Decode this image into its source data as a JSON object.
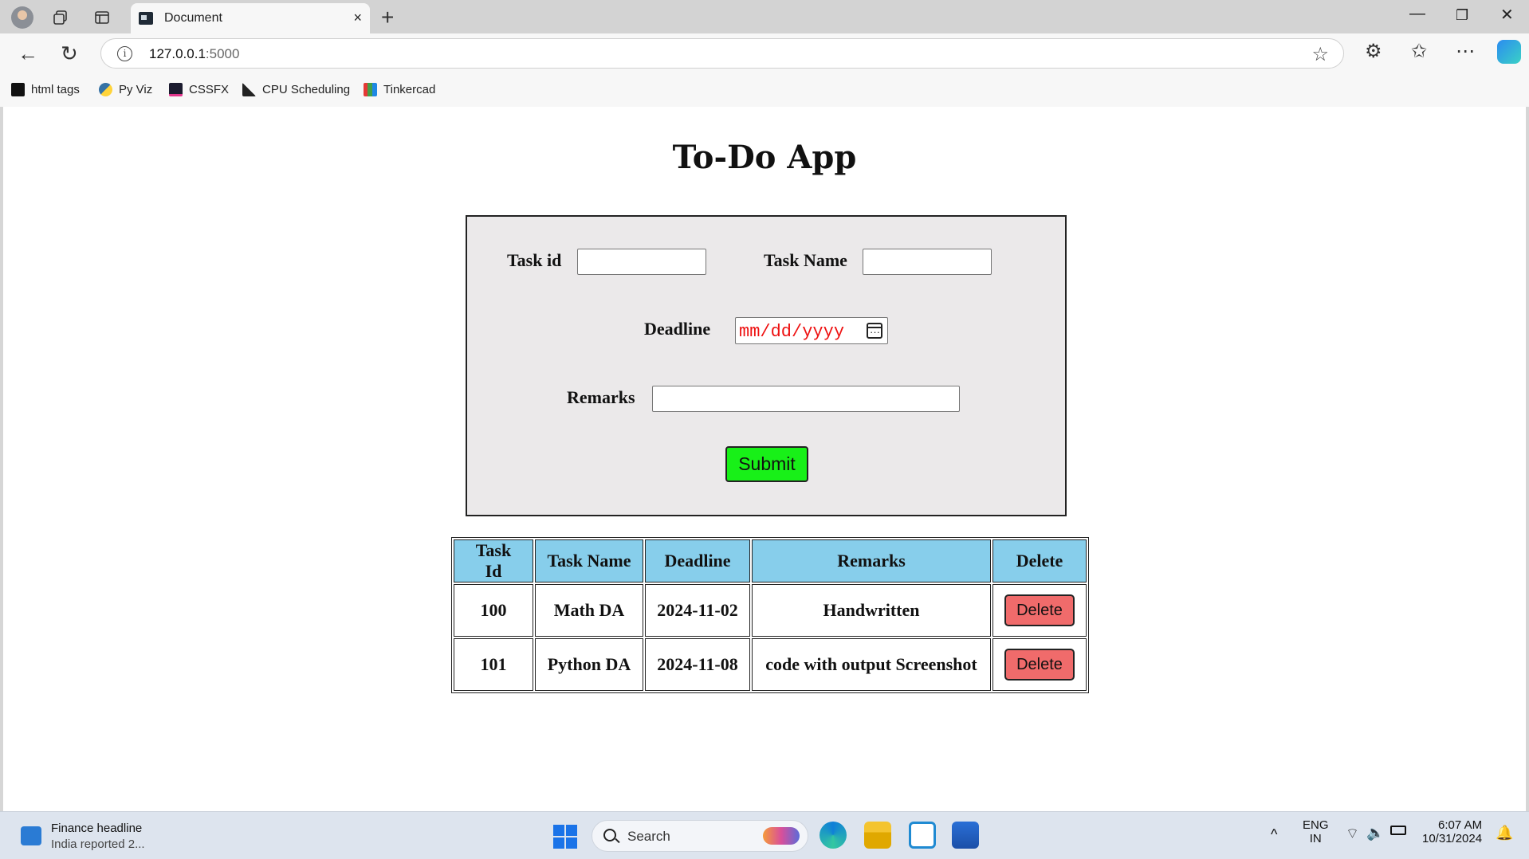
{
  "browser": {
    "tab_title": "Document",
    "tab_close": "×",
    "new_tab": "+",
    "address_host": "127.0.0.1",
    "address_port": ":5000",
    "bookmarks": [
      "html tags",
      "Py Viz",
      "CSSFX",
      "CPU Scheduling",
      "Tinkercad"
    ]
  },
  "page": {
    "title": "To-Do App",
    "form": {
      "task_id_label": "Task id",
      "task_name_label": "Task Name",
      "deadline_label": "Deadline",
      "deadline_placeholder": "mm/dd/yyyy",
      "remarks_label": "Remarks",
      "submit_label": "Submit"
    },
    "table": {
      "headers": [
        "Task Id",
        "Task Name",
        "Deadline",
        "Remarks",
        "Delete"
      ],
      "rows": [
        {
          "id": "100",
          "name": "Math DA",
          "deadline": "2024-11-02",
          "remarks": "Handwritten",
          "delete_label": "Delete"
        },
        {
          "id": "101",
          "name": "Python DA",
          "deadline": "2024-11-08",
          "remarks": "code with output Screenshot",
          "delete_label": "Delete"
        }
      ]
    }
  },
  "taskbar": {
    "news_title": "Finance headline",
    "news_sub": "India reported 2...",
    "search_label": "Search",
    "lang_1": "ENG",
    "lang_2": "IN",
    "time": "6:07 AM",
    "date": "10/31/2024"
  },
  "colors": {
    "header_bg": "#87ceeb",
    "submit_bg": "#18f018",
    "delete_bg": "#f06b6b",
    "form_bg": "#ebe9ea"
  }
}
